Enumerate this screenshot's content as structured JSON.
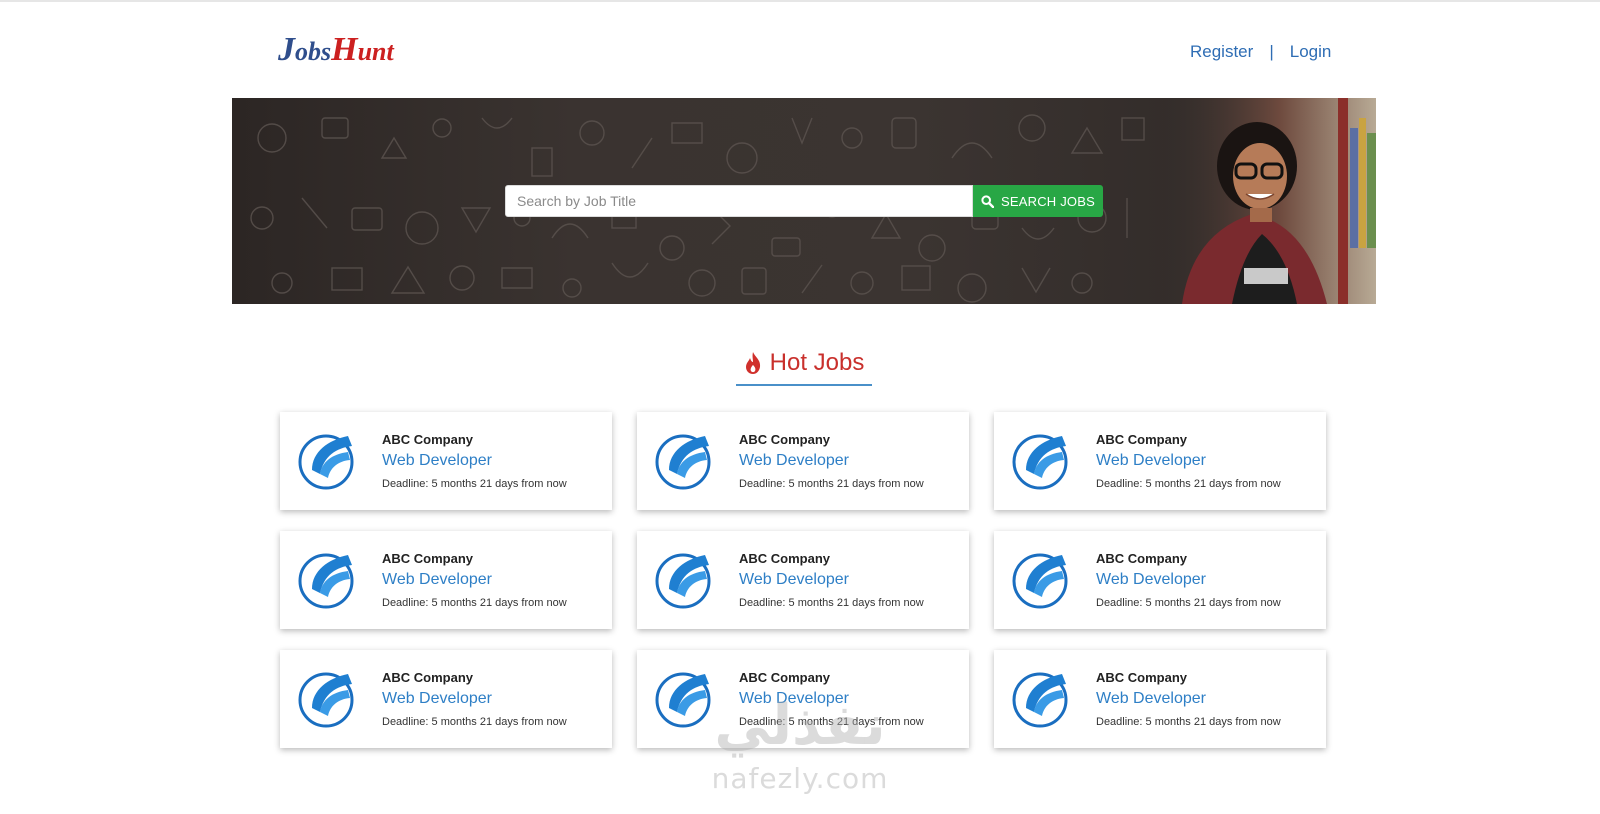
{
  "header": {
    "logo": {
      "part1_initial": "J",
      "part1_rest": "obs",
      "part2_initial": "H",
      "part2_rest": "unt"
    },
    "nav": {
      "register": "Register",
      "separator": "|",
      "login": "Login"
    }
  },
  "hero": {
    "search": {
      "placeholder": "Search by Job Title",
      "value": "",
      "button_label": "SEARCH JOBS",
      "button_icon": "search-icon"
    }
  },
  "section": {
    "title": "Hot Jobs",
    "icon": "fire-icon"
  },
  "jobs": [
    {
      "company": "ABC Company",
      "title": "Web Developer",
      "deadline": "Deadline: 5 months 21 days from now"
    },
    {
      "company": "ABC Company",
      "title": "Web Developer",
      "deadline": "Deadline: 5 months 21 days from now"
    },
    {
      "company": "ABC Company",
      "title": "Web Developer",
      "deadline": "Deadline: 5 months 21 days from now"
    },
    {
      "company": "ABC Company",
      "title": "Web Developer",
      "deadline": "Deadline: 5 months 21 days from now"
    },
    {
      "company": "ABC Company",
      "title": "Web Developer",
      "deadline": "Deadline: 5 months 21 days from now"
    },
    {
      "company": "ABC Company",
      "title": "Web Developer",
      "deadline": "Deadline: 5 months 21 days from now"
    },
    {
      "company": "ABC Company",
      "title": "Web Developer",
      "deadline": "Deadline: 5 months 21 days from now"
    },
    {
      "company": "ABC Company",
      "title": "Web Developer",
      "deadline": "Deadline: 5 months 21 days from now"
    },
    {
      "company": "ABC Company",
      "title": "Web Developer",
      "deadline": "Deadline: 5 months 21 days from now"
    }
  ],
  "watermark": {
    "arabic": "نفذلي",
    "latin": "nafezly.com"
  },
  "colors": {
    "brand_blue": "#2f4e8c",
    "brand_red": "#cc2020",
    "link": "#2e7fc6",
    "search_button": "#28a745",
    "hot_title": "#c9302c"
  }
}
